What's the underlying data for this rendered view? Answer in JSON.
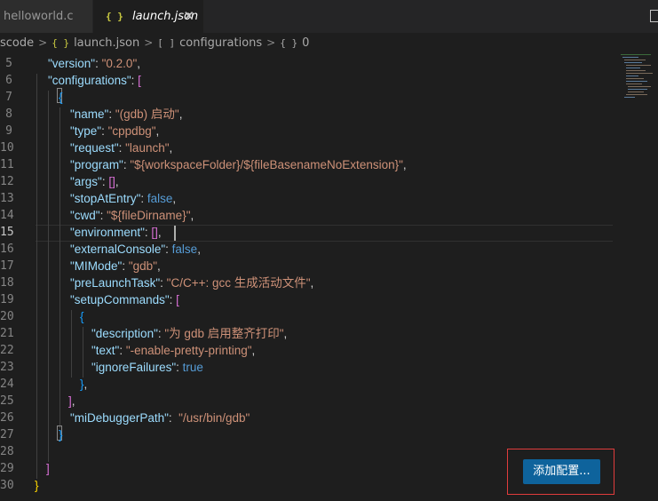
{
  "tabs": [
    {
      "label": "helloworld.c",
      "active": false
    },
    {
      "label": "launch.json",
      "active": true
    }
  ],
  "icons": {
    "json": "{ }",
    "close": "✕",
    "split_editor": "split-editor-icon"
  },
  "breadcrumb": {
    "root": "scode",
    "file": "launch.json",
    "array_icon": "[ ]",
    "array": "configurations",
    "object_icon": "{ }",
    "object": "0"
  },
  "editor": {
    "line_numbers": [
      "5",
      "6",
      "7",
      "8",
      "9",
      "10",
      "11",
      "12",
      "13",
      "14",
      "15",
      "16",
      "17",
      "18",
      "19",
      "20",
      "21",
      "22",
      "23",
      "24",
      "25",
      "26",
      "27",
      "28",
      "29",
      "30"
    ],
    "active_line": "15",
    "lines": {
      "l5": {
        "key": "\"version\"",
        "value": "\"0.2.0\""
      },
      "l6": {
        "key": "\"configurations\""
      },
      "l8": {
        "key": "\"name\"",
        "value": "\"(gdb) 启动\""
      },
      "l9": {
        "key": "\"type\"",
        "value": "\"cppdbg\""
      },
      "l10": {
        "key": "\"request\"",
        "value": "\"launch\""
      },
      "l11": {
        "key": "\"program\"",
        "value": "\"${workspaceFolder}/${fileBasenameNoExtension}\""
      },
      "l12": {
        "key": "\"args\""
      },
      "l13": {
        "key": "\"stopAtEntry\"",
        "value": "false"
      },
      "l14": {
        "key": "\"cwd\"",
        "value": "\"${fileDirname}\""
      },
      "l15": {
        "key": "\"environment\""
      },
      "l16": {
        "key": "\"externalConsole\"",
        "value": "false"
      },
      "l17": {
        "key": "\"MIMode\"",
        "value": "\"gdb\""
      },
      "l18": {
        "key": "\"preLaunchTask\"",
        "value": "\"C/C++: gcc 生成活动文件\""
      },
      "l19": {
        "key": "\"setupCommands\""
      },
      "l21": {
        "key": "\"description\"",
        "value": "\"为 gdb 启用整齐打印\""
      },
      "l22": {
        "key": "\"text\"",
        "value": "\"-enable-pretty-printing\""
      },
      "l23": {
        "key": "\"ignoreFailures\"",
        "value": "true"
      },
      "l26": {
        "key": "\"miDebuggerPath\"",
        "value": "\"/usr/bin/gdb\""
      }
    }
  },
  "actions": {
    "add_configuration": "添加配置..."
  },
  "colors": {
    "key": "#9cdcfe",
    "string": "#ce9178",
    "boolean": "#569cd6",
    "button": "#0e639c",
    "highlight_border": "#e03c3c"
  }
}
